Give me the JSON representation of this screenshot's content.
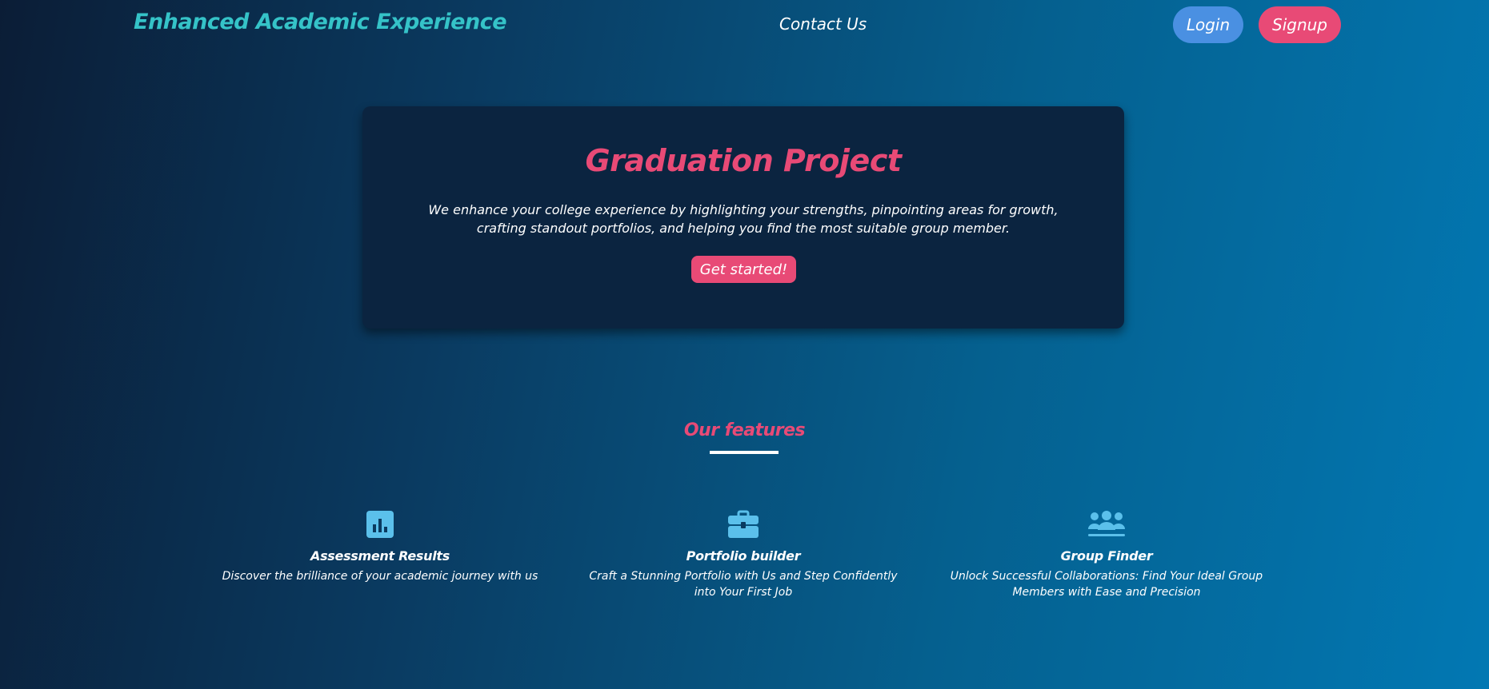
{
  "navbar": {
    "brand": "Enhanced Academic Experience",
    "contact_link": "Contact Us",
    "login_label": "Login",
    "signup_label": "Signup"
  },
  "hero": {
    "title": "Graduation Project",
    "description": "We enhance your college experience by highlighting your strengths, pinpointing areas for growth, crafting standout portfolios, and helping you find the most suitable group member.",
    "cta_label": "Get started!"
  },
  "features": {
    "heading": "Our features",
    "items": [
      {
        "icon": "bar-chart-icon",
        "title": "Assessment Results",
        "description": "Discover the brilliance of your academic journey with us"
      },
      {
        "icon": "briefcase-icon",
        "title": "Portfolio builder",
        "description": "Craft a Stunning Portfolio with Us and Step Confidently into Your First Job"
      },
      {
        "icon": "users-icon",
        "title": "Group Finder",
        "description": "Unlock Successful Collaborations: Find Your Ideal Group Members with Ease and Precision"
      }
    ]
  },
  "colors": {
    "brand": "#35c3c8",
    "accent": "#e84a76",
    "login_button": "#4a90e2",
    "icon": "#5bc0eb",
    "card_background": "#0b2440"
  }
}
